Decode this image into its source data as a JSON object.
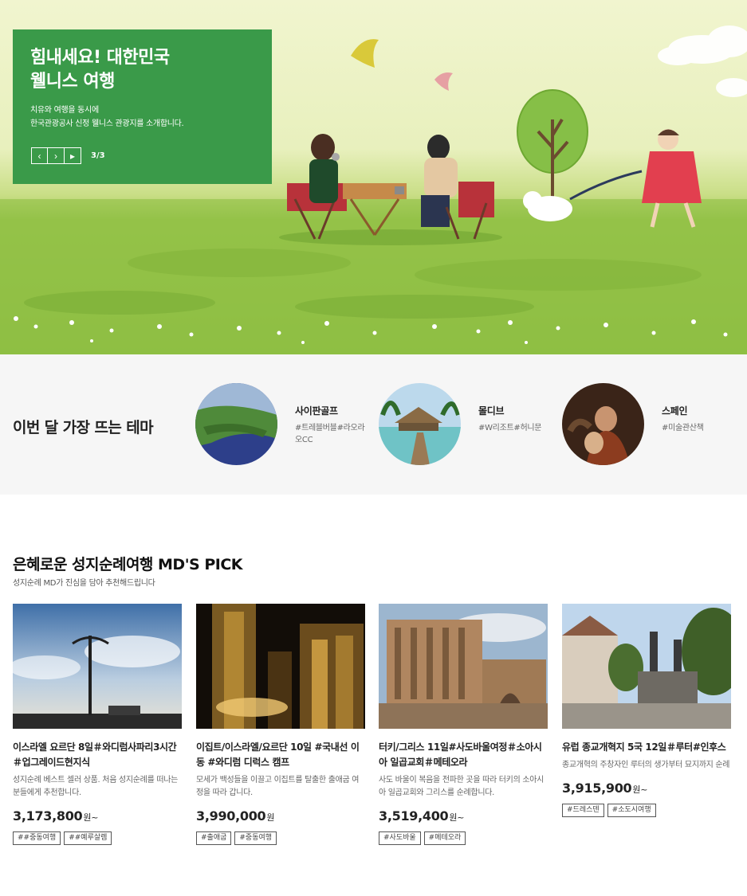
{
  "hero": {
    "title_line1": "힘내세요! 대한민국",
    "title_line2": "웰니스 여행",
    "desc_line1": "치유와 여행을 동시에",
    "desc_line2": "한국관광공사 신정 웰니스 관광지를 소개합니다.",
    "prev_icon": "‹",
    "next_icon": "›",
    "play_icon": "▸",
    "counter": "3/3"
  },
  "themes": {
    "title": "이번 달 가장 뜨는 테마",
    "items": [
      {
        "name": "사이판골프",
        "tags": "#트레블버블#라오라오CC"
      },
      {
        "name": "몰디브",
        "tags": "#W리조트#허니문"
      },
      {
        "name": "스페인",
        "tags": "#미술관산책"
      }
    ]
  },
  "pick": {
    "title": "은혜로운 성지순례여행 MD'S PICK",
    "subtitle": "성지순례 MD가 진심을 담아 추천해드립니다",
    "cards": [
      {
        "name": "이스라엘 요르단 8일＃와디럼사파리3시간＃업그레이드현지식",
        "desc": "성지순례 베스트 셀러 상품. 처음 성지순례를 떠나는 분들에게 추천합니다.",
        "price": "3,173,800",
        "unit": "원~",
        "tags": [
          "##중동여행",
          "##예루살렘"
        ]
      },
      {
        "name": "이집트/이스라엘/요르단 10일 #국내선 이동 #와디럼 디럭스 캠프",
        "desc": "모세가 백성들을 이끌고 이집트를 탈출한 출애굽 여정을 따라 갑니다.",
        "price": "3,990,000",
        "unit": "원",
        "tags": [
          "#출애굽",
          "#중동여행"
        ]
      },
      {
        "name": "터키/그리스 11일#사도바울여정＃소아시아 일곱교회＃메테오라",
        "desc": "사도 바울이 복음을 전파한 곳을 따라 터키의 소아시아 일곱교회와 그리스를 순례합니다.",
        "price": "3,519,400",
        "unit": "원~",
        "tags": [
          "#사도바울",
          "#메테오라"
        ]
      },
      {
        "name": "유럽 종교개혁지 5국 12일＃루터#인후스",
        "desc": "종교개혁의 주창자인 루터의 생가부터 묘지까지 순례",
        "price": "3,915,900",
        "unit": "원~",
        "tags": [
          "#드레스덴",
          "#소도시여행"
        ]
      }
    ]
  },
  "colors": {
    "hero_box": "#3a9a49",
    "theme_bg": "#f6f6f6"
  }
}
